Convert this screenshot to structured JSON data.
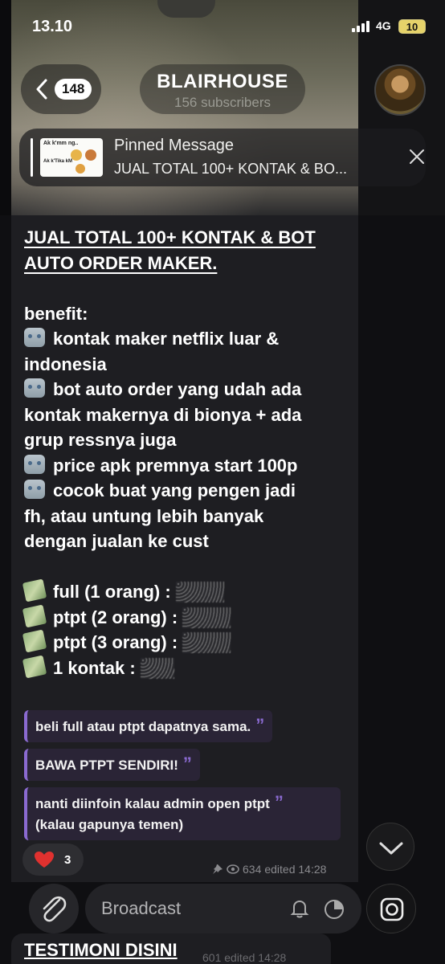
{
  "status_bar": {
    "time": "13.10",
    "network": "4G",
    "battery": "10"
  },
  "header": {
    "back_count": "148",
    "channel_name": "BLAIRHOUSE",
    "subscribers": "156 subscribers"
  },
  "pinned": {
    "label": "Pinned Message",
    "text": "JUAL TOTAL 100+ KONTAK & BO...",
    "thumb_line1": "Ak k'mm ng..",
    "thumb_line2": "Ak k'Tika kM"
  },
  "message": {
    "headline_1": "JUAL TOTAL 100+ KONTAK & BOT",
    "headline_2": "AUTO ORDER MAKER.",
    "benefit_label": "benefit:",
    "benefits": [
      [
        "kontak maker netflix luar &",
        "indonesia"
      ],
      [
        "bot auto order yang udah ada",
        "kontak makernya di bionya + ada",
        "grup ressnya juga"
      ],
      [
        "price apk premnya start 100p"
      ],
      [
        "cocok buat yang pengen jadi",
        "fh, atau untung lebih banyak",
        "dengan jualan ke cust"
      ]
    ],
    "prices": [
      "full (1 orang) :",
      "ptpt (2 orang) :",
      "ptpt (3 orang) :",
      "1 kontak :"
    ]
  },
  "quotes": [
    "beli full atau ptpt dapatnya sama.",
    "BAWA PTPT SENDIRI!",
    "nanti diinfoin kalau admin open ptpt",
    "(kalau gapunya temen)"
  ],
  "reaction": {
    "emoji": "heart",
    "count": "3"
  },
  "meta": {
    "views": "634",
    "edited": "edited 14:28"
  },
  "composer": {
    "placeholder": "Broadcast"
  },
  "next_message": {
    "title": "TESTIMONI DISINI",
    "meta": "601 edited 14:28"
  },
  "colors": {
    "accent": "#8a6ad0",
    "bubble": "#1e1e22",
    "heart": "#e0312f"
  }
}
